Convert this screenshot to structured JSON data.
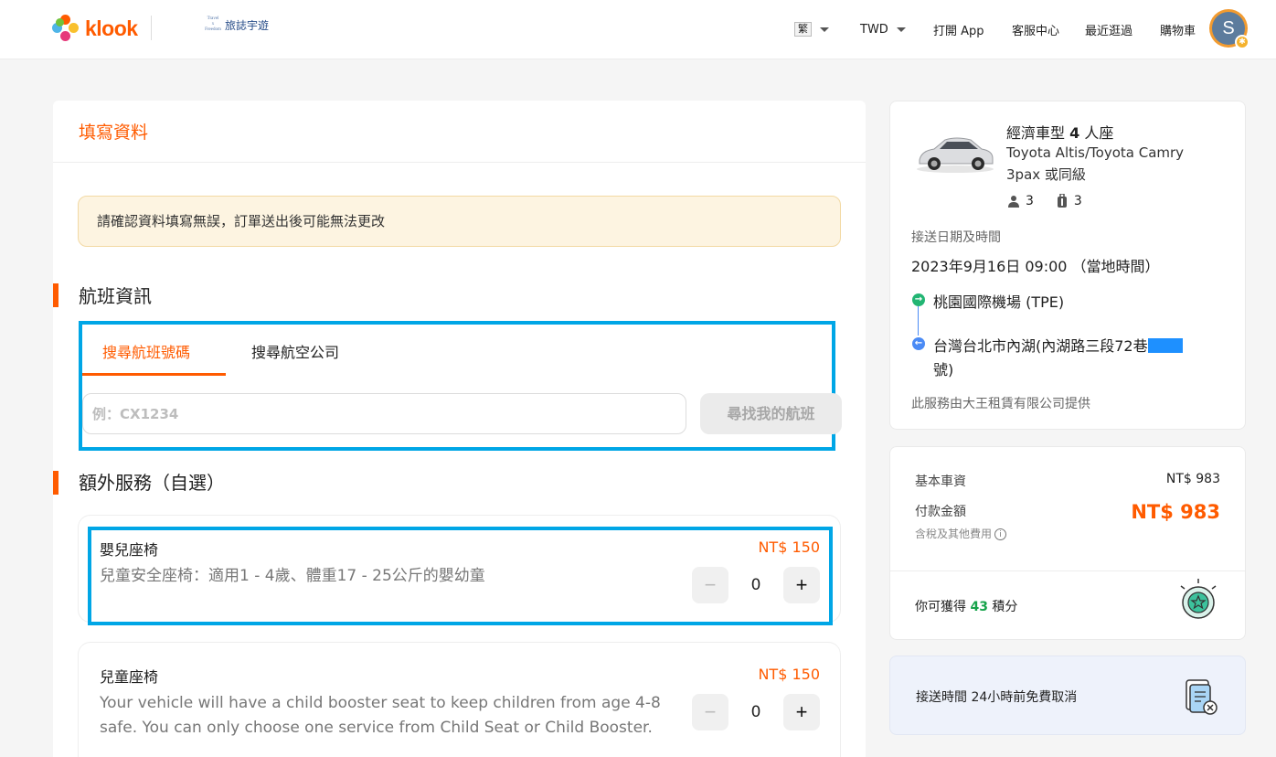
{
  "header": {
    "brand": "klook",
    "partner": {
      "tagline_top": "Travel",
      "tagline_mid": "x",
      "tagline_bottom": "Freedom",
      "name": "旅誌宇遊"
    },
    "nav": {
      "language": "繁",
      "currency": "TWD",
      "open_app": "打開 App",
      "support": "客服中心",
      "recent": "最近逛過",
      "cart": "購物車"
    },
    "avatar_initial": "S"
  },
  "form": {
    "title": "填寫資料",
    "notice": "請確認資料填寫無誤，訂單送出後可能無法更改",
    "flight_section": {
      "title": "航班資訊",
      "tabs": [
        {
          "label": "搜尋航班號碼",
          "active": true
        },
        {
          "label": "搜尋航空公司",
          "active": false
        }
      ],
      "input_value": "",
      "input_placeholder": "例：CX1234",
      "search_button": "尋找我的航班"
    },
    "extras_section": {
      "title": "額外服務（自選）",
      "services": [
        {
          "name": "嬰兒座椅",
          "price": "NT$ 150",
          "description": "兒童安全座椅：適用1 - 4歲、體重17 - 25公斤的嬰幼童",
          "quantity": "0"
        },
        {
          "name": "兒童座椅",
          "price": "NT$ 150",
          "description": "Your vehicle will have a child booster seat to keep children from age 4-8 safe. You can only choose one service from Child Seat or Child Booster.",
          "quantity": "0"
        }
      ]
    }
  },
  "summary": {
    "car_type_prefix": "經濟車型 ",
    "car_type_seats": "4",
    "car_type_suffix": " 人座",
    "car_models": "Toyota Altis/Toyota Camry",
    "car_note": "3pax 或同級",
    "passengers": "3",
    "luggage": "3",
    "pickup_label": "接送日期及時間",
    "pickup_datetime": "2023年9月16日 09:00 （當地時間）",
    "from": "桃園國際機場 (TPE)",
    "to_line1": "台灣台北市內湖(內湖路三段72巷",
    "to_line2": "號)",
    "provider": "此服務由大王租賃有限公司提供"
  },
  "pricing": {
    "base_label": "基本車資",
    "base_value": "NT$ 983",
    "pay_label": "付款金額",
    "pay_value": "NT$ 983",
    "tax_note": "含稅及其他費用",
    "points_prefix": "你可獲得 ",
    "points_value": "43",
    "points_suffix": " 積分"
  },
  "cancellation": {
    "text": "接送時間 24小時前免費取消"
  },
  "colors": {
    "accent": "#ff5b00",
    "highlight_border": "#00a6e6",
    "points_green": "#16a34a"
  }
}
